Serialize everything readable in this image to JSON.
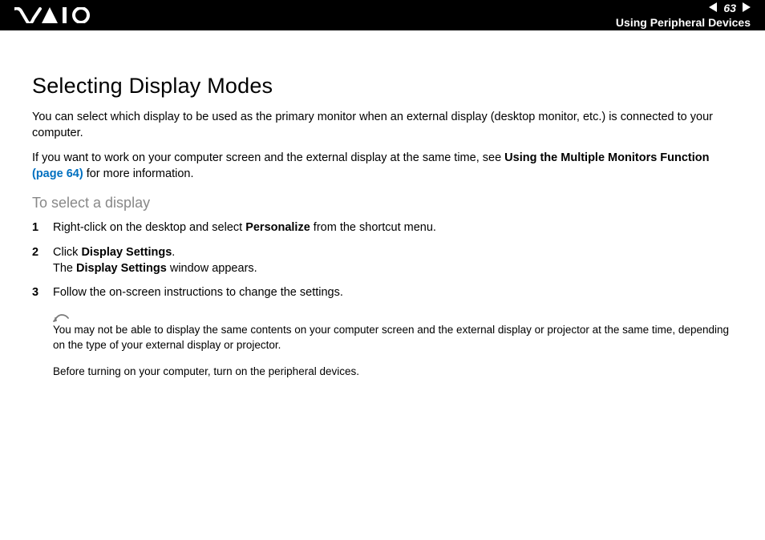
{
  "header": {
    "page_number": "63",
    "section_name": "Using Peripheral Devices"
  },
  "title": "Selecting Display Modes",
  "intro": {
    "p1": "You can select which display to be used as the primary monitor when an external display (desktop monitor, etc.) is connected to your computer.",
    "p2_part1": "If you want to work on your computer screen and the external display at the same time, see ",
    "p2_bold": "Using the Multiple Monitors Function ",
    "p2_link": "(page 64)",
    "p2_part2": " for more information."
  },
  "subheading": "To select a display",
  "steps": [
    {
      "num": "1",
      "parts": [
        {
          "t": "Right-click on the desktop and select ",
          "b": false
        },
        {
          "t": "Personalize",
          "b": true
        },
        {
          "t": " from the shortcut menu.",
          "b": false
        }
      ]
    },
    {
      "num": "2",
      "parts": [
        {
          "t": "Click ",
          "b": false
        },
        {
          "t": "Display Settings",
          "b": true
        },
        {
          "t": ".",
          "b": false
        },
        {
          "t": "\n",
          "b": false
        },
        {
          "t": "The ",
          "b": false
        },
        {
          "t": "Display Settings",
          "b": true
        },
        {
          "t": " window appears.",
          "b": false
        }
      ]
    },
    {
      "num": "3",
      "parts": [
        {
          "t": "Follow the on-screen instructions to change the settings.",
          "b": false
        }
      ]
    }
  ],
  "note": {
    "p1": "You may not be able to display the same contents on your computer screen and the external display or projector at the same time, depending on the type of your external display or projector.",
    "p2": "Before turning on your computer, turn on the peripheral devices."
  }
}
